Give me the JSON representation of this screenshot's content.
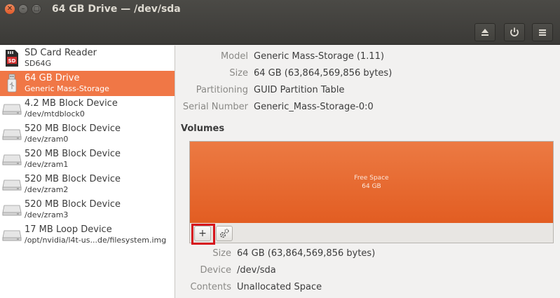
{
  "window": {
    "title": "64 GB Drive — /dev/sda",
    "close_glyph": "✕",
    "minimize_glyph": "–",
    "maximize_glyph": "□"
  },
  "header_buttons": {
    "eject_icon": "eject-icon",
    "power_icon": "power-icon",
    "menu_icon": "menu-icon"
  },
  "sidebar": {
    "items": [
      {
        "name": "SD Card Reader",
        "sub": "SD64G",
        "icon": "sd-card-icon"
      },
      {
        "name": "64 GB Drive",
        "sub": "Generic Mass-Storage",
        "icon": "usb-drive-icon"
      },
      {
        "name": "4.2 MB Block Device",
        "sub": "/dev/mtdblock0",
        "icon": "disk-icon"
      },
      {
        "name": "520 MB Block Device",
        "sub": "/dev/zram0",
        "icon": "disk-icon"
      },
      {
        "name": "520 MB Block Device",
        "sub": "/dev/zram1",
        "icon": "disk-icon"
      },
      {
        "name": "520 MB Block Device",
        "sub": "/dev/zram2",
        "icon": "disk-icon"
      },
      {
        "name": "520 MB Block Device",
        "sub": "/dev/zram3",
        "icon": "disk-icon"
      },
      {
        "name": "17 MB Loop Device",
        "sub": "/opt/nvidia/l4t-us...de/filesystem.img",
        "icon": "disk-icon"
      }
    ],
    "sd_badge": "SD",
    "selected_index": 1
  },
  "drive": {
    "model_label": "Model",
    "model": "Generic Mass-Storage (1.11)",
    "size_label": "Size",
    "size": "64 GB (63,864,569,856 bytes)",
    "partitioning_label": "Partitioning",
    "partitioning": "GUID Partition Table",
    "serial_label": "Serial Number",
    "serial": "Generic_Mass-Storage-0:0"
  },
  "volumes": {
    "title": "Volumes",
    "segment_title": "Free Space",
    "segment_size": "64 GB",
    "add_label": "+",
    "add_icon": "plus-icon",
    "settings_icon": "gears-icon"
  },
  "volume_details": {
    "size_label": "Size",
    "size": "64 GB (63,864,569,856 bytes)",
    "device_label": "Device",
    "device": "/dev/sda",
    "contents_label": "Contents",
    "contents": "Unallocated Space"
  },
  "colors": {
    "accent": "#f07746",
    "free_space": "#e8693a",
    "highlight": "#d6141c"
  }
}
